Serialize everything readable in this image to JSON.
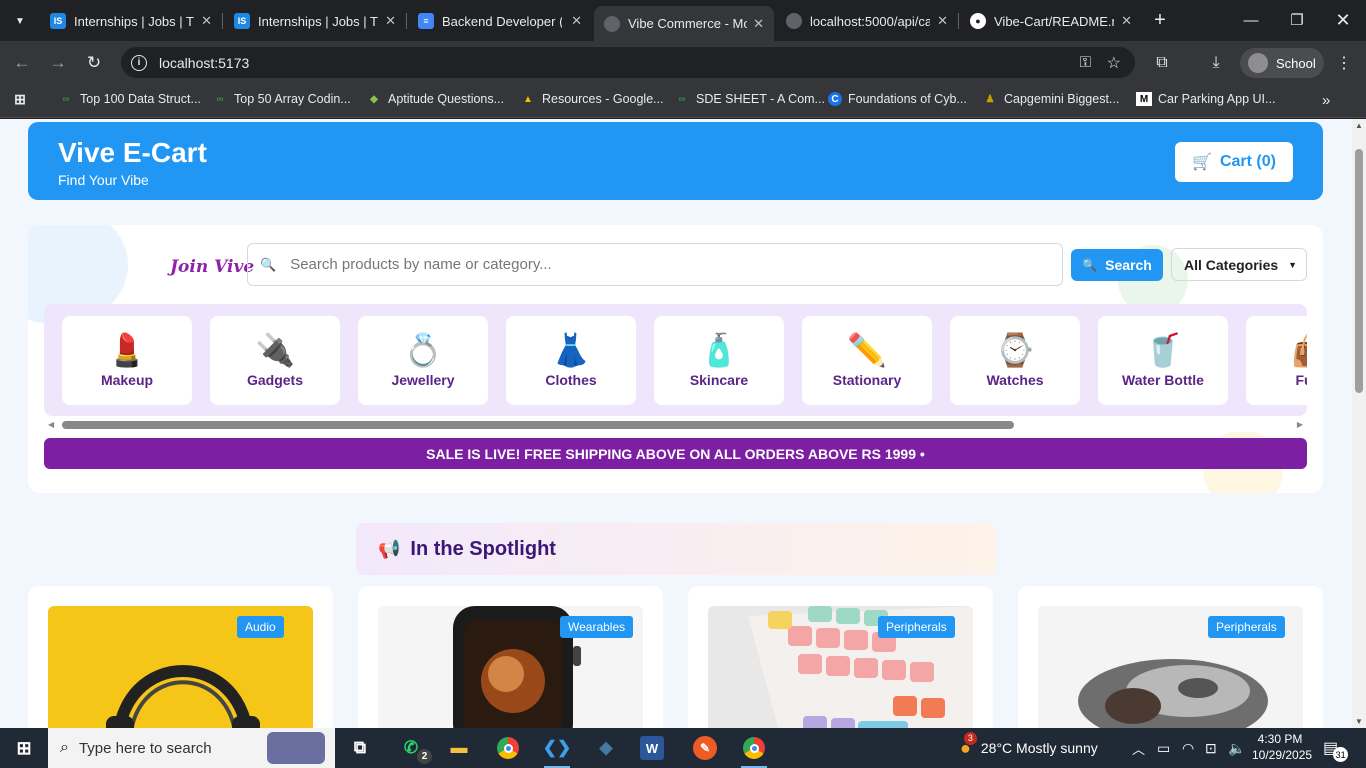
{
  "browser": {
    "tabs": [
      {
        "title": "Internships | Jobs | Tra",
        "favicon": "IS",
        "color": "#1e88e5"
      },
      {
        "title": "Internships | Jobs | Tra",
        "favicon": "IS",
        "color": "#1e88e5"
      },
      {
        "title": "Backend Developer (I",
        "favicon": "docs-icon",
        "color": "#4285f4"
      },
      {
        "title": "Vibe Commerce - Mo",
        "favicon": "globe-icon",
        "color": "#9aa0a6"
      },
      {
        "title": "localhost:5000/api/ca",
        "favicon": "globe-icon",
        "color": "#9aa0a6"
      },
      {
        "title": "Vibe-Cart/README.m",
        "favicon": "github-icon",
        "color": "#ffffff"
      }
    ],
    "url": "localhost:5173",
    "profile_label": "School",
    "bookmarks": [
      "Top 100 Data Struct...",
      "Top 50 Array Codin...",
      "Aptitude Questions...",
      "Resources - Google...",
      "SDE SHEET - A Com...",
      "Foundations of Cyb...",
      "Capgemini Biggest...",
      "Car Parking App UI..."
    ]
  },
  "header": {
    "brand": "Vive E-Cart",
    "tagline": "Find Your Vibe",
    "cart_label": "Cart (0)"
  },
  "search": {
    "logo_text": "Join Vive",
    "placeholder": "Search products by name or category...",
    "button_label": "Search",
    "category_select": "All Categories"
  },
  "categories": [
    {
      "label": "Makeup",
      "icon": "lipstick-icon",
      "glyph": "💄"
    },
    {
      "label": "Gadgets",
      "icon": "plug-icon",
      "glyph": "🔌"
    },
    {
      "label": "Jewellery",
      "icon": "ring-icon",
      "glyph": "💍"
    },
    {
      "label": "Clothes",
      "icon": "dress-icon",
      "glyph": "👗"
    },
    {
      "label": "Skincare",
      "icon": "lotion-icon",
      "glyph": "🧴"
    },
    {
      "label": "Stationary",
      "icon": "pencil-icon",
      "glyph": "✏️"
    },
    {
      "label": "Watches",
      "icon": "watch-icon",
      "glyph": "⌚"
    },
    {
      "label": "Water Bottle",
      "icon": "cup-icon",
      "glyph": "🥤"
    },
    {
      "label": "Furn",
      "icon": "bag-icon",
      "glyph": "👜"
    }
  ],
  "sale_banner": "SALE IS LIVE! FREE SHIPPING ABOVE ON ALL ORDERS ABOVE RS 1999  •",
  "spotlight": {
    "title": "In the Spotlight"
  },
  "products": [
    {
      "badge": "Audio"
    },
    {
      "badge": "Wearables"
    },
    {
      "badge": "Peripherals"
    },
    {
      "badge": "Peripherals"
    }
  ],
  "taskbar": {
    "search_placeholder": "Type here to search",
    "whatsapp_count": "2",
    "weather_alert": "3",
    "weather": "28°C  Mostly sunny",
    "time": "4:30 PM",
    "date": "10/29/2025",
    "notifications": "31"
  },
  "colors": {
    "primary": "#2196f3",
    "purple": "#7d1fa2",
    "category_text": "#5b2486"
  }
}
